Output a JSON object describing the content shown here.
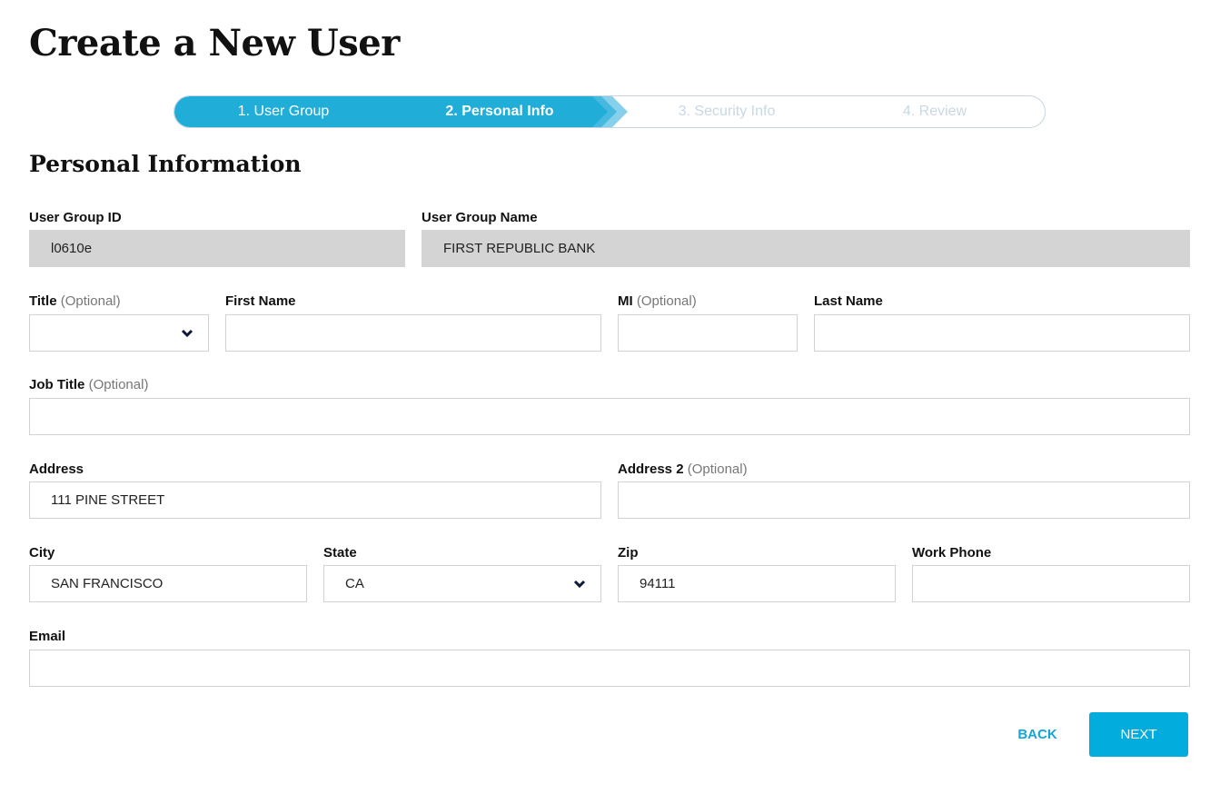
{
  "page": {
    "title": "Create a New User"
  },
  "stepper": {
    "steps": [
      {
        "label": "1. User Group",
        "state": "done"
      },
      {
        "label": "2. Personal Info",
        "state": "active"
      },
      {
        "label": "3. Security Info",
        "state": "todo"
      },
      {
        "label": "4. Review",
        "state": "todo"
      }
    ]
  },
  "section": {
    "title": "Personal Information"
  },
  "optional_text": "(Optional)",
  "fields": {
    "user_group_id": {
      "label": "User Group ID",
      "value": "l0610e"
    },
    "user_group_name": {
      "label": "User Group Name",
      "value": "FIRST REPUBLIC BANK"
    },
    "title": {
      "label": "Title",
      "value": ""
    },
    "first_name": {
      "label": "First Name",
      "value": ""
    },
    "mi": {
      "label": "MI",
      "value": ""
    },
    "last_name": {
      "label": "Last Name",
      "value": ""
    },
    "job_title": {
      "label": "Job Title",
      "value": ""
    },
    "address": {
      "label": "Address",
      "value": "111 PINE STREET"
    },
    "address2": {
      "label": "Address 2",
      "value": ""
    },
    "city": {
      "label": "City",
      "value": "SAN FRANCISCO"
    },
    "state": {
      "label": "State",
      "value": "CA"
    },
    "zip": {
      "label": "Zip",
      "value": "94111"
    },
    "work_phone": {
      "label": "Work Phone",
      "value": ""
    },
    "email": {
      "label": "Email",
      "value": ""
    }
  },
  "buttons": {
    "back": "BACK",
    "next": "NEXT"
  },
  "colors": {
    "accent": "#20add8",
    "button": "#02acdc",
    "readonly_bg": "#d4d4d4"
  }
}
